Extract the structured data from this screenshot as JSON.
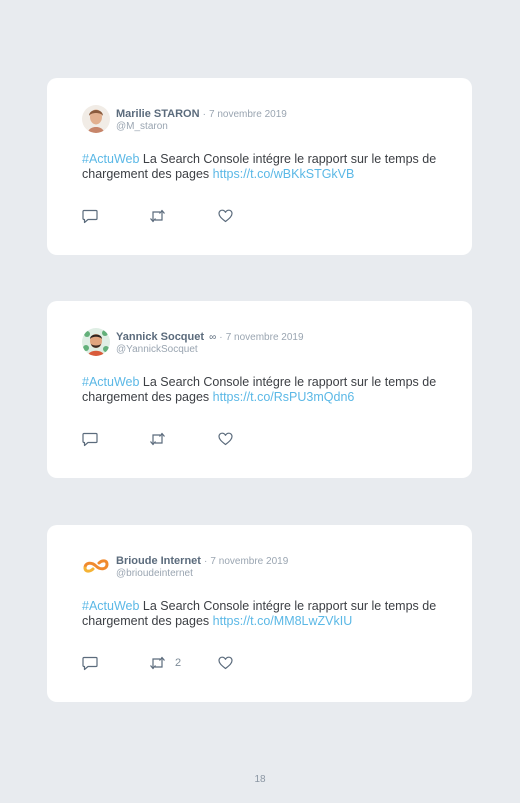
{
  "tweets": [
    {
      "author": "Marilie STARON",
      "separator": "·",
      "date": "7 novembre 2019",
      "handle": "@M_staron",
      "hashtag": "#ActuWeb",
      "text": " La Search Console intégre le rapport sur le temps de chargement des pages ",
      "link": "https://t.co/wBKkSTGkVB",
      "retweets": ""
    },
    {
      "author": "Yannick Socquet",
      "badge": "∞",
      "separator": "·",
      "date": "7 novembre 2019",
      "handle": "@YannickSocquet",
      "hashtag": "#ActuWeb",
      "text": " La Search Console intégre le rapport sur le temps de chargement des pages ",
      "link": "https://t.co/RsPU3mQdn6",
      "retweets": ""
    },
    {
      "author": "Brioude Internet",
      "separator": "·",
      "date": "7 novembre 2019",
      "handle": "@brioudeinternet",
      "hashtag": "#ActuWeb",
      "text": " La Search Console intégre le rapport sur le temps de chargement des pages ",
      "link": "https://t.co/MM8LwZVkIU",
      "retweets": "2"
    }
  ],
  "icons": {
    "reply": "reply-icon",
    "retweet": "retweet-icon",
    "like": "heart-icon"
  },
  "colors": {
    "background": "#e8ebef",
    "link": "#5bb8e6",
    "name": "#5b6b7c",
    "muted": "#9aa5b1"
  },
  "page_number": "18"
}
